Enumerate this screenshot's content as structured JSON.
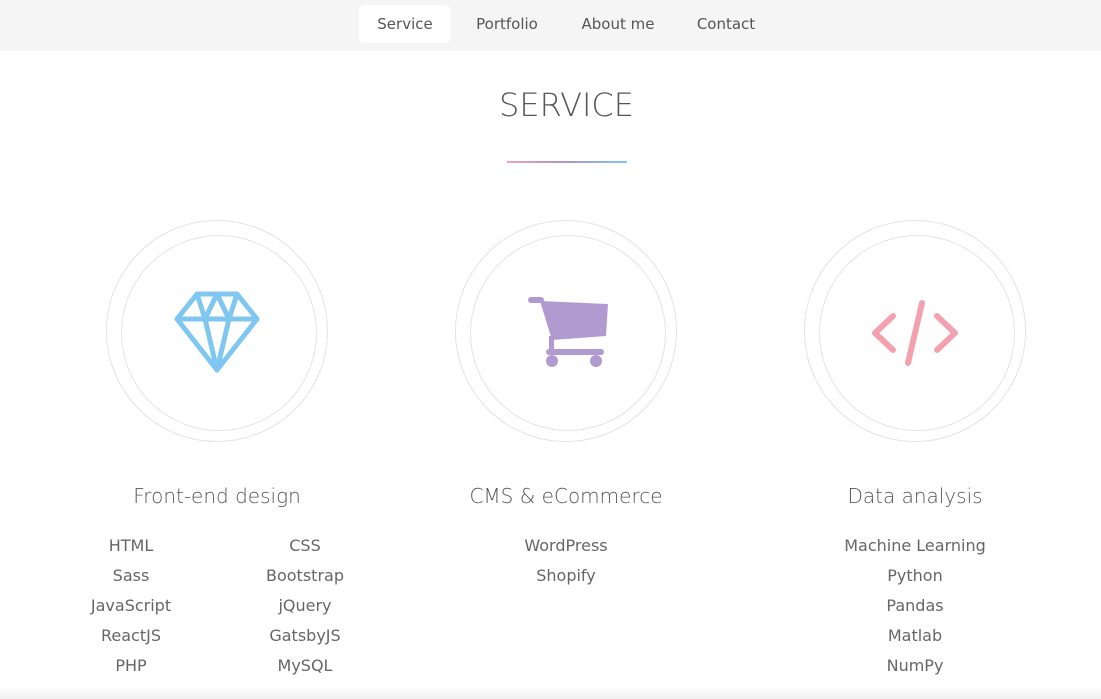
{
  "nav": {
    "items": [
      {
        "label": "Service",
        "active": true
      },
      {
        "label": "Portfolio",
        "active": false
      },
      {
        "label": "About me",
        "active": false
      },
      {
        "label": "Contact",
        "active": false
      }
    ]
  },
  "section": {
    "title": "SERVICE"
  },
  "colors": {
    "diamond": "#7fc7f0",
    "cart": "#b09ad0",
    "code": "#f3a1ae"
  },
  "services": [
    {
      "title": "Front-end design",
      "icon": "diamond-icon",
      "skills_left": [
        "HTML",
        "Sass",
        "JavaScript",
        "ReactJS",
        "PHP"
      ],
      "skills_right": [
        "CSS",
        "Bootstrap",
        "jQuery",
        "GatsbyJS",
        "MySQL"
      ]
    },
    {
      "title": "CMS & eCommerce",
      "icon": "shopping-cart-icon",
      "skills": [
        "WordPress",
        "Shopify"
      ]
    },
    {
      "title": "Data analysis",
      "icon": "code-icon",
      "skills": [
        "Machine Learning",
        "Python",
        "Pandas",
        "Matlab",
        "NumPy"
      ]
    }
  ]
}
